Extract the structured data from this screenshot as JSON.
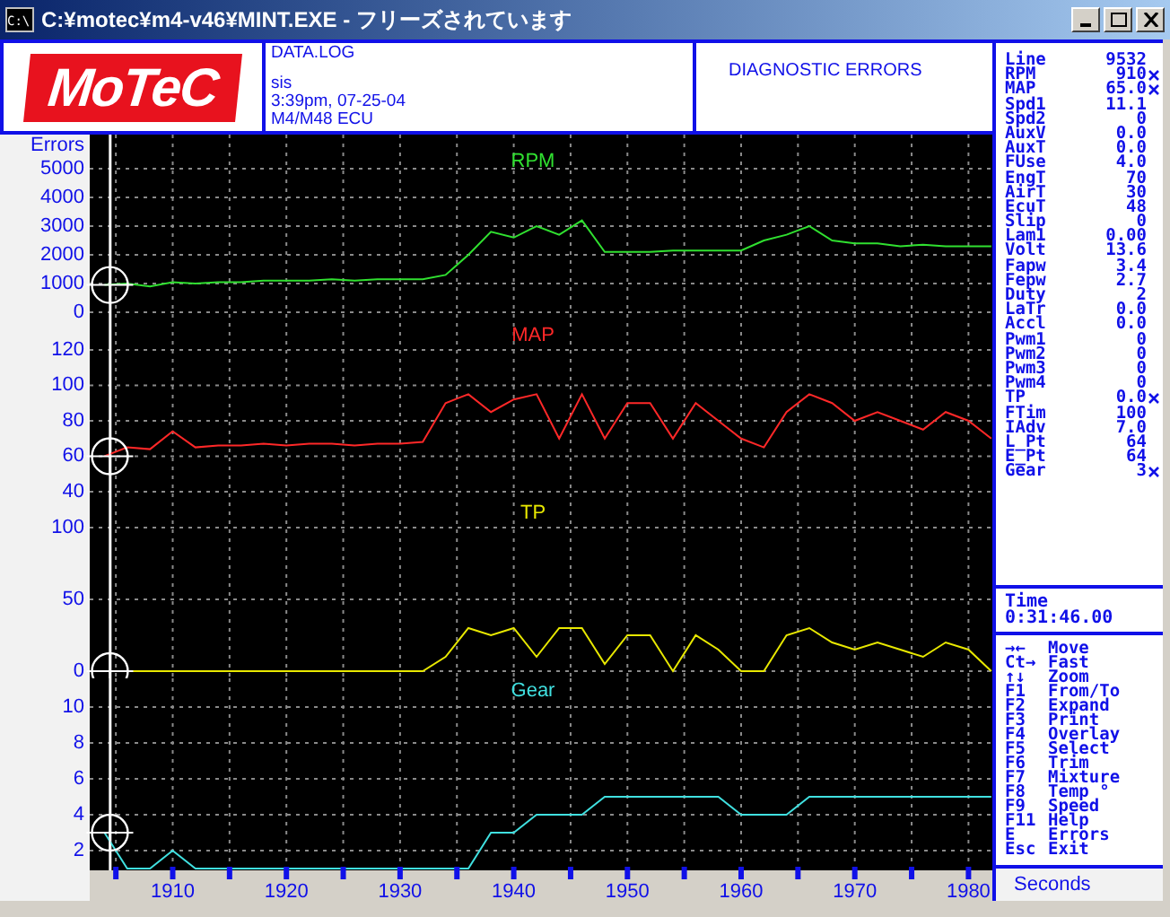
{
  "window": {
    "title": "C:¥motec¥m4-v46¥MINT.EXE - フリーズされています",
    "icon_text": "C:\\"
  },
  "header": {
    "logo": "MoTeC",
    "file_info": [
      "DATA.LOG",
      "sis",
      "3:39pm, 07-25-04",
      "M4/M48 ECU"
    ],
    "diagnostics_title": "DIAGNOSTIC ERRORS"
  },
  "errors_axis_label": "Errors",
  "charts": [
    {
      "chart_data": {
        "type": "line",
        "grid": true,
        "ref_lines": [
          {
            "axis": "x",
            "value": 1904.5
          }
        ],
        "x": [
          1904,
          1906,
          1908,
          1910,
          1912,
          1914,
          1916,
          1918,
          1920,
          1922,
          1924,
          1926,
          1928,
          1930,
          1932,
          1934,
          1936,
          1938,
          1940,
          1942,
          1944,
          1946,
          1948,
          1950,
          1952,
          1954,
          1956,
          1958,
          1960,
          1962,
          1964,
          1966,
          1968,
          1970,
          1972,
          1974,
          1976,
          1978,
          1980,
          1982
        ],
        "xlim": [
          1902.7,
          1982.1
        ],
        "ylim": [
          -375,
          6190
        ],
        "yticks": [
          0,
          1000,
          2000,
          3000,
          4000,
          5000
        ],
        "series": [
          {
            "name": "RPM",
            "color": "#30e030",
            "values": [
              950,
              1000,
              900,
              1050,
              1000,
              1050,
              1050,
              1100,
              1100,
              1100,
              1150,
              1100,
              1150,
              1150,
              1150,
              1300,
              2000,
              2800,
              2600,
              3000,
              2700,
              3200,
              2100,
              2100,
              2100,
              2150,
              2150,
              2150,
              2150,
              2500,
              2700,
              3000,
              2500,
              2400,
              2400,
              2300,
              2350,
              2300,
              2300,
              2300
            ]
          }
        ]
      }
    },
    {
      "chart_data": {
        "type": "line",
        "grid": true,
        "ref_lines": [
          {
            "axis": "x",
            "value": 1904.5
          }
        ],
        "x": [
          1904,
          1906,
          1908,
          1910,
          1912,
          1914,
          1916,
          1918,
          1920,
          1922,
          1924,
          1926,
          1928,
          1930,
          1932,
          1934,
          1936,
          1938,
          1940,
          1942,
          1944,
          1946,
          1948,
          1950,
          1952,
          1954,
          1956,
          1958,
          1960,
          1962,
          1964,
          1966,
          1968,
          1970,
          1972,
          1974,
          1976,
          1978,
          1980,
          1982
        ],
        "xlim": [
          1902.7,
          1982.1
        ],
        "ylim": [
          33.9,
          135.2
        ],
        "yticks": [
          40,
          60,
          80,
          100,
          120
        ],
        "series": [
          {
            "name": "MAP",
            "color": "#ff2828",
            "values": [
              60,
              65,
              64,
              74,
              65,
              66,
              66,
              67,
              66,
              67,
              67,
              66,
              67,
              67,
              68,
              90,
              95,
              85,
              92,
              95,
              70,
              95,
              70,
              90,
              90,
              70,
              90,
              80,
              70,
              65,
              85,
              95,
              90,
              80,
              85,
              80,
              75,
              85,
              80,
              70
            ]
          }
        ]
      }
    },
    {
      "chart_data": {
        "type": "line",
        "grid": true,
        "ref_lines": [
          {
            "axis": "x",
            "value": 1904.5
          }
        ],
        "x": [
          1904,
          1906,
          1908,
          1910,
          1912,
          1914,
          1916,
          1918,
          1920,
          1922,
          1924,
          1926,
          1928,
          1930,
          1932,
          1934,
          1936,
          1938,
          1940,
          1942,
          1944,
          1946,
          1948,
          1950,
          1952,
          1954,
          1956,
          1958,
          1960,
          1962,
          1964,
          1966,
          1968,
          1970,
          1972,
          1974,
          1976,
          1978,
          1980,
          1982
        ],
        "xlim": [
          1902.7,
          1982.1
        ],
        "ylim": [
          -5,
          117.5
        ],
        "yticks": [
          0,
          50,
          100
        ],
        "series": [
          {
            "name": "TP",
            "color": "#e8e800",
            "values": [
              0,
              0,
              0,
              0,
              0,
              0,
              0,
              0,
              0,
              0,
              0,
              0,
              0,
              0,
              0,
              10,
              30,
              25,
              30,
              10,
              30,
              30,
              5,
              25,
              25,
              0,
              25,
              15,
              0,
              0,
              25,
              30,
              20,
              15,
              20,
              15,
              10,
              20,
              15,
              0
            ]
          }
        ]
      }
    },
    {
      "chart_data": {
        "type": "line",
        "grid": true,
        "ref_lines": [
          {
            "axis": "x",
            "value": 1904.5
          }
        ],
        "x": [
          1904,
          1906,
          1908,
          1910,
          1912,
          1914,
          1916,
          1918,
          1920,
          1922,
          1924,
          1926,
          1928,
          1930,
          1932,
          1934,
          1936,
          1938,
          1940,
          1942,
          1944,
          1946,
          1948,
          1950,
          1952,
          1954,
          1956,
          1958,
          1960,
          1962,
          1964,
          1966,
          1968,
          1970,
          1972,
          1974,
          1976,
          1978,
          1980,
          1982
        ],
        "xlim": [
          1902.7,
          1982.1
        ],
        "ylim": [
          0.9,
          11.6
        ],
        "yticks": [
          2,
          4,
          6,
          8,
          10
        ],
        "xticks": [
          1910,
          1920,
          1930,
          1940,
          1950,
          1960,
          1970,
          1980
        ],
        "series": [
          {
            "name": "Gear",
            "color": "#40e0e0",
            "values": [
              3,
              1,
              1,
              2,
              1,
              1,
              1,
              1,
              1,
              1,
              1,
              1,
              1,
              1,
              1,
              1,
              1,
              3,
              3,
              4,
              4,
              4,
              5,
              5,
              5,
              5,
              5,
              5,
              4,
              4,
              4,
              5,
              5,
              5,
              5,
              5,
              5,
              5,
              5,
              5
            ]
          }
        ]
      }
    }
  ],
  "channels": [
    {
      "name": "Line",
      "value": "9532",
      "plotted": false
    },
    {
      "name": "RPM",
      "value": "910",
      "plotted": true
    },
    {
      "name": "MAP",
      "value": "65.0",
      "plotted": true
    },
    {
      "name": "Spd1",
      "value": "11.1",
      "plotted": false
    },
    {
      "name": "Spd2",
      "value": "0",
      "plotted": false
    },
    {
      "name": "AuxV",
      "value": "0.0",
      "plotted": false
    },
    {
      "name": "AuxT",
      "value": "0.0",
      "plotted": false
    },
    {
      "name": "FUse",
      "value": "4.0",
      "plotted": false
    },
    {
      "name": "EngT",
      "value": "70",
      "plotted": false
    },
    {
      "name": "AirT",
      "value": "30",
      "plotted": false
    },
    {
      "name": "EcuT",
      "value": "48",
      "plotted": false
    },
    {
      "name": "Slip",
      "value": "0",
      "plotted": false
    },
    {
      "name": "Lam1",
      "value": "0.00",
      "plotted": false
    },
    {
      "name": "Volt",
      "value": "13.6",
      "plotted": false
    },
    {
      "name": "Fapw",
      "value": "3.4",
      "plotted": false
    },
    {
      "name": "Fepw",
      "value": "2.7",
      "plotted": false
    },
    {
      "name": "Duty",
      "value": "2",
      "plotted": false
    },
    {
      "name": "LaTr",
      "value": "0.0",
      "plotted": false
    },
    {
      "name": "Accl",
      "value": "0.0",
      "plotted": false
    },
    {
      "name": "Pwm1",
      "value": "0",
      "plotted": false
    },
    {
      "name": "Pwm2",
      "value": "0",
      "plotted": false
    },
    {
      "name": "Pwm3",
      "value": "0",
      "plotted": false
    },
    {
      "name": "Pwm4",
      "value": "0",
      "plotted": false
    },
    {
      "name": "TP",
      "value": "0.0",
      "plotted": true
    },
    {
      "name": "FTim",
      "value": "100",
      "plotted": false
    },
    {
      "name": "IAdv",
      "value": "7.0",
      "plotted": false
    },
    {
      "name": "L_Pt",
      "value": "64",
      "plotted": false
    },
    {
      "name": "E_Pt",
      "value": "64",
      "plotted": false
    },
    {
      "name": "Gear",
      "value": "3",
      "plotted": true
    }
  ],
  "time": {
    "label": "Time",
    "value": "0:31:46.00"
  },
  "keys": [
    {
      "key": "→←",
      "action": "Move"
    },
    {
      "key": "Ct→",
      "action": "Fast"
    },
    {
      "key": "↑↓",
      "action": "Zoom"
    },
    {
      "key": "F1",
      "action": "From/To"
    },
    {
      "key": "F2",
      "action": "Expand"
    },
    {
      "key": "F3",
      "action": "Print"
    },
    {
      "key": "F4",
      "action": "Overlay"
    },
    {
      "key": "F5",
      "action": "Select"
    },
    {
      "key": "F6",
      "action": "Trim"
    },
    {
      "key": "F7",
      "action": "Mixture"
    },
    {
      "key": "F8",
      "action": "Temp °"
    },
    {
      "key": "F9",
      "action": "Speed"
    },
    {
      "key": "F11",
      "action": "Help"
    },
    {
      "key": "E",
      "action": "Errors"
    },
    {
      "key": "Esc",
      "action": "Exit"
    }
  ],
  "x_axis_unit": "Seconds"
}
